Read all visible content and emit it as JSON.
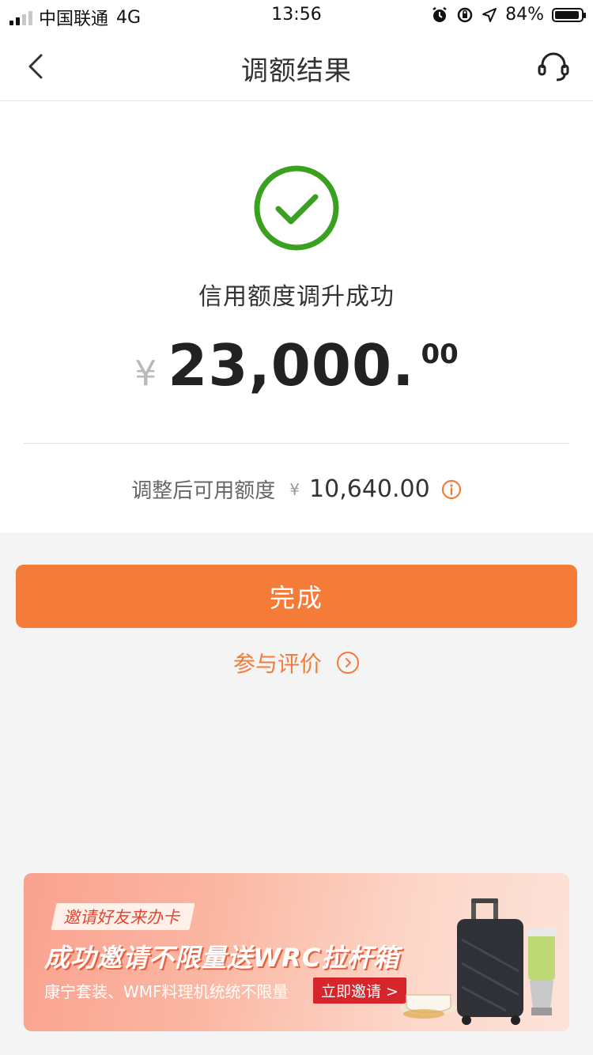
{
  "status_bar": {
    "carrier": "中国联通",
    "network": "4G",
    "time": "13:56",
    "battery": "84%"
  },
  "nav": {
    "title": "调额结果",
    "back_icon": "chevron-left-icon",
    "service_icon": "headset-icon"
  },
  "result": {
    "icon": "check-circle-icon",
    "message": "信用额度调升成功",
    "currency_symbol": "¥",
    "amount_integer": "23,000.",
    "amount_decimal": "00",
    "available_label": "调整后可用额度",
    "available_currency": "¥",
    "available_value": "10,640.00",
    "info_icon": "info-icon"
  },
  "actions": {
    "done_label": "完成",
    "evaluate_label": "参与评价",
    "evaluate_icon": "chevron-right-circle-icon"
  },
  "banner": {
    "tag": "邀请好友来办卡",
    "title": "成功邀请不限量送WRC拉杆箱",
    "subtitle": "康宁套装、WMF料理机统统不限量",
    "cta": "立即邀请 >"
  },
  "colors": {
    "accent": "#f47c38",
    "success": "#3aa01f",
    "banner_red": "#d6262c"
  }
}
